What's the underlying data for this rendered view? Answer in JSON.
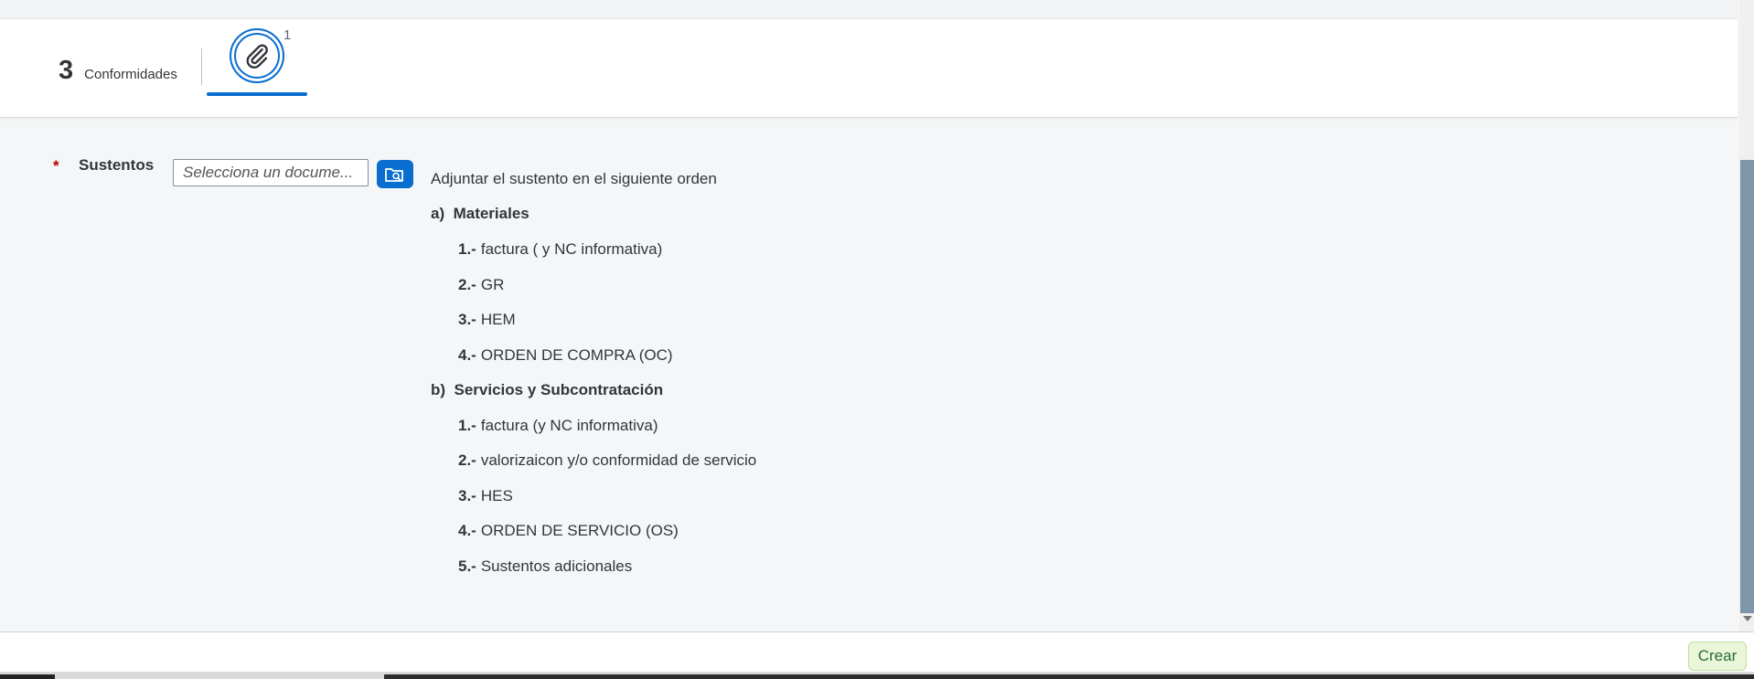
{
  "header": {
    "conformidades_count": "3",
    "conformidades_label": "Conformidades",
    "attachments_badge": "1"
  },
  "form": {
    "sustentos_required_marker": "*",
    "sustentos_label": "Sustentos",
    "document_placeholder": "Selecciona un docume..."
  },
  "instructions": {
    "intro": "Adjuntar el sustento en el siguiente orden",
    "sections": [
      {
        "marker": "a)",
        "title": "Materiales",
        "items": [
          {
            "num": "1.-",
            "text": "factura ( y NC informativa)"
          },
          {
            "num": "2.-",
            "text": "GR"
          },
          {
            "num": "3.-",
            "text": "HEM"
          },
          {
            "num": "4.-",
            "text": "ORDEN DE COMPRA (OC)"
          }
        ]
      },
      {
        "marker": "b)",
        "title": "Servicios y Subcontratación",
        "items": [
          {
            "num": "1.-",
            "text": "factura (y NC informativa)"
          },
          {
            "num": "2.-",
            "text": "valorizaicon y/o conformidad de servicio"
          },
          {
            "num": "3.-",
            "text": "HES"
          },
          {
            "num": "4.-",
            "text": "ORDEN DE SERVICIO (OS)"
          },
          {
            "num": "5.-",
            "text": "Sustentos adicionales"
          }
        ]
      }
    ]
  },
  "footer": {
    "create_label": "Crear"
  },
  "colors": {
    "accent": "#0a6ed1",
    "required": "#bb0000",
    "accept_bg": "#eaf5d9",
    "accept_text": "#256f3a"
  },
  "icons": {
    "attachment": "paperclip-icon",
    "browse": "folder-search-icon"
  }
}
